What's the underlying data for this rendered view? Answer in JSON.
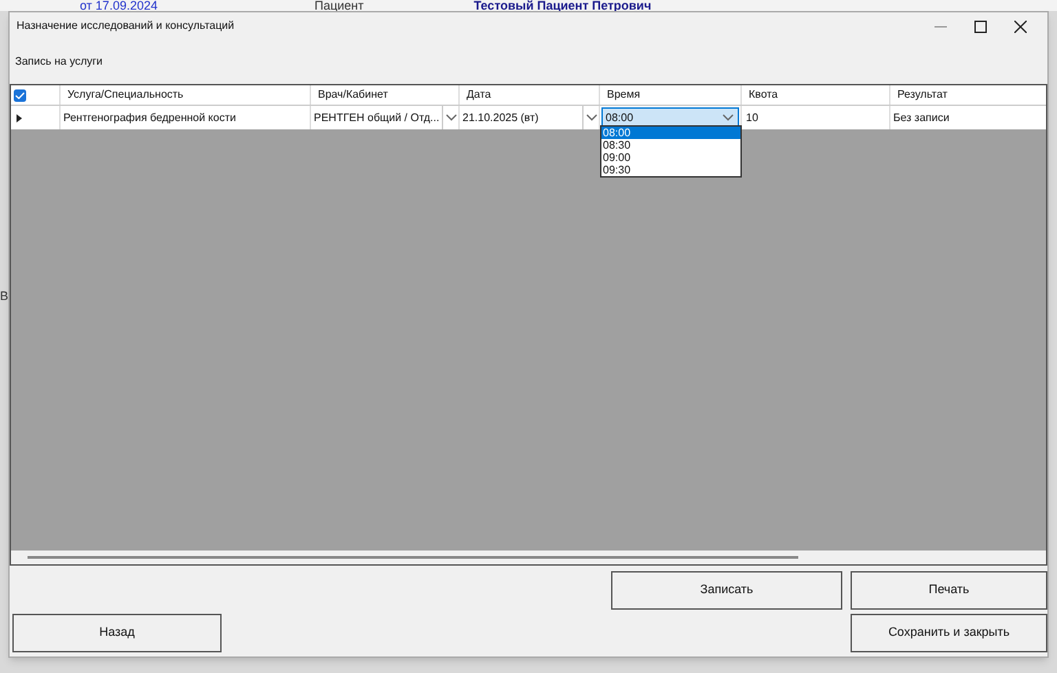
{
  "background": {
    "date": "от 17.09.2024",
    "patient_label": "Пациент",
    "patient_name": "Тестовый Пациент Петрович",
    "side_label": "В"
  },
  "window": {
    "title": "Назначение исследований и консультаций"
  },
  "section_title": "Запись на услуги",
  "table": {
    "select_all_checked": true,
    "columns": [
      {
        "label": "Услуга/Специальность"
      },
      {
        "label": "Врач/Кабинет"
      },
      {
        "label": "Дата"
      },
      {
        "label": "Время"
      },
      {
        "label": "Квота"
      },
      {
        "label": "Результат"
      }
    ],
    "rows": [
      {
        "current": true,
        "service": "Рентгенография бедренной кости",
        "doctor": "РЕНТГЕН общий / Отд...",
        "date": "21.10.2025 (вт)",
        "time": "08:00",
        "quota": "10",
        "result": "Без записи"
      }
    ]
  },
  "time_dropdown": {
    "options": [
      {
        "label": "08:00",
        "selected": true
      },
      {
        "label": "08:30",
        "selected": false
      },
      {
        "label": "09:00",
        "selected": false
      },
      {
        "label": "09:30",
        "selected": false
      }
    ]
  },
  "buttons": [
    {
      "label": "Записать"
    },
    {
      "label": "Печать"
    },
    {
      "label": "Назад"
    },
    {
      "label": "Сохранить и закрыть"
    }
  ]
}
